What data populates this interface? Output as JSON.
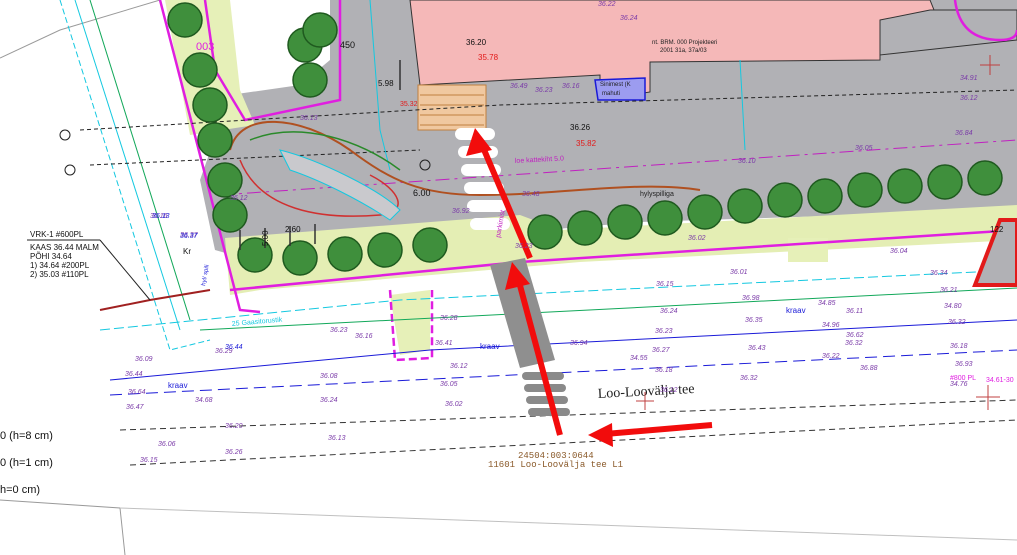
{
  "viewer": {
    "title": ""
  },
  "colors": {
    "paving": "#b4b4b8",
    "road_asphalt": "#a9a9ad",
    "building": "#f4b9b9",
    "grass": "#e6f0b8",
    "boundary": "#e01ee0",
    "arrow": "#f20c0c",
    "tree": "#3f8f3c",
    "tree_dark": "#1f5a1f",
    "cad_blue": "#1a1ad8",
    "cad_cyan": "#14c8e0",
    "cad_green": "#12a85a",
    "elev_purple": "#7a3aa8",
    "text_red": "#e21a1a"
  },
  "legend": {
    "rows": [
      "0 (h=8 cm)",
      "0 (h=1 cm)",
      "h=0 cm)"
    ]
  },
  "callout": {
    "line1": "VRK-1 #600PL",
    "line2": "KAAS 36.44 MALM",
    "line3": "PÕHI 34.64",
    "line4": "1) 34.64 #200PL",
    "line5": "2) 35.03 #110PL"
  },
  "parcel": {
    "id": "24504:003:0644",
    "name": "11601 Loo-Loovälja tee L1"
  },
  "road_name": "Loo-Loovälja tee",
  "labels": {
    "kraav1": "kraav",
    "kraav2": "kraav",
    "kraav3": "kraav",
    "kr": "Kr",
    "label_450": "450",
    "label_600": "6.00",
    "label_598": "5.98",
    "label_260": "2.60",
    "label_500": "5.00",
    "label_003": "003",
    "label_122": "122",
    "pl_label": "#800 PL",
    "pl_label2": "34.61-30",
    "gas_note": "25 Gaasitorustik",
    "sidewalk_note": "loe kattekiht 5.0",
    "parking_note": "parkimist",
    "hairpin_note": "hylyspilliga",
    "hairpin_note2": "hyl/ spili",
    "building_note": "nt. BRM. 000 Projekteeri",
    "building_note2": "2001 31a, 37a/03",
    "building_note3": "Sinimest (K",
    "building_note4": "mahuti"
  },
  "elevations_red": [
    "35.78",
    "35.82",
    "35.32"
  ],
  "elevations_black": [
    "36.20",
    "36.26"
  ],
  "elevations_purple": [
    "36.49",
    "36.13",
    "36.48",
    "36.10",
    "36.84",
    "36.05",
    "36.02",
    "36.23",
    "36.92",
    "36.37",
    "36.16",
    "36.12",
    "36.23",
    "36.28",
    "36.01",
    "36.15",
    "36.04",
    "36.94",
    "34.55",
    "36.88",
    "36.16",
    "36.41",
    "36.29",
    "36.09",
    "36.44",
    "36.64",
    "36.47",
    "34.68",
    "36.06",
    "36.15",
    "36.20",
    "36.08",
    "36.24",
    "36.26",
    "36.13",
    "36.05",
    "36.02",
    "36.12",
    "36.27",
    "36.18",
    "36.12",
    "36.32",
    "36.22",
    "36.23",
    "36.35",
    "36.43",
    "34.96",
    "34.85",
    "36.24",
    "36.34",
    "36.21",
    "34.80",
    "36.32",
    "36.18",
    "36.93",
    "34.76",
    "36.98",
    "36.11",
    "34.91",
    "36.12",
    "36.32",
    "36.62",
    "36.23",
    "36.16",
    "36.22",
    "36.24"
  ],
  "elevations_blue": [
    "36.44",
    "36.37",
    "36.13"
  ]
}
